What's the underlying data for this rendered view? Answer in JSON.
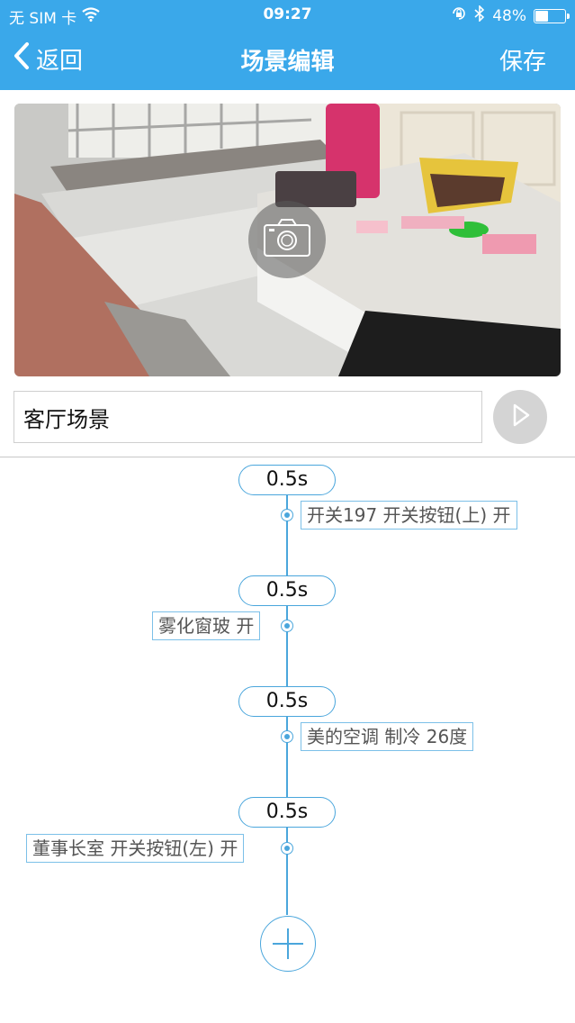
{
  "status_bar": {
    "carrier": "无 SIM 卡",
    "time": "09:27",
    "battery_percent": "48%",
    "battery_level": 0.48,
    "icons": [
      "wifi-icon",
      "rotation-lock-icon",
      "bluetooth-icon",
      "battery-icon"
    ]
  },
  "nav": {
    "back_label": "返回",
    "title": "场景编辑",
    "save_label": "保存"
  },
  "scene": {
    "name": "客厅场景",
    "photo_icon": "camera-icon",
    "play_icon": "play-icon"
  },
  "timeline": {
    "steps": [
      {
        "delay": "0.5s",
        "action": "开关197 开关按钮(上) 开"
      },
      {
        "delay": "0.5s",
        "action": "雾化窗玻 开"
      },
      {
        "delay": "0.5s",
        "action": "美的空调 制冷 26度"
      },
      {
        "delay": "0.5s",
        "action": "董事长室 开关按钮(左) 开"
      }
    ],
    "add_icon": "add-icon"
  },
  "colors": {
    "header": "#3aa8ea",
    "accent": "#4aa6dc"
  }
}
